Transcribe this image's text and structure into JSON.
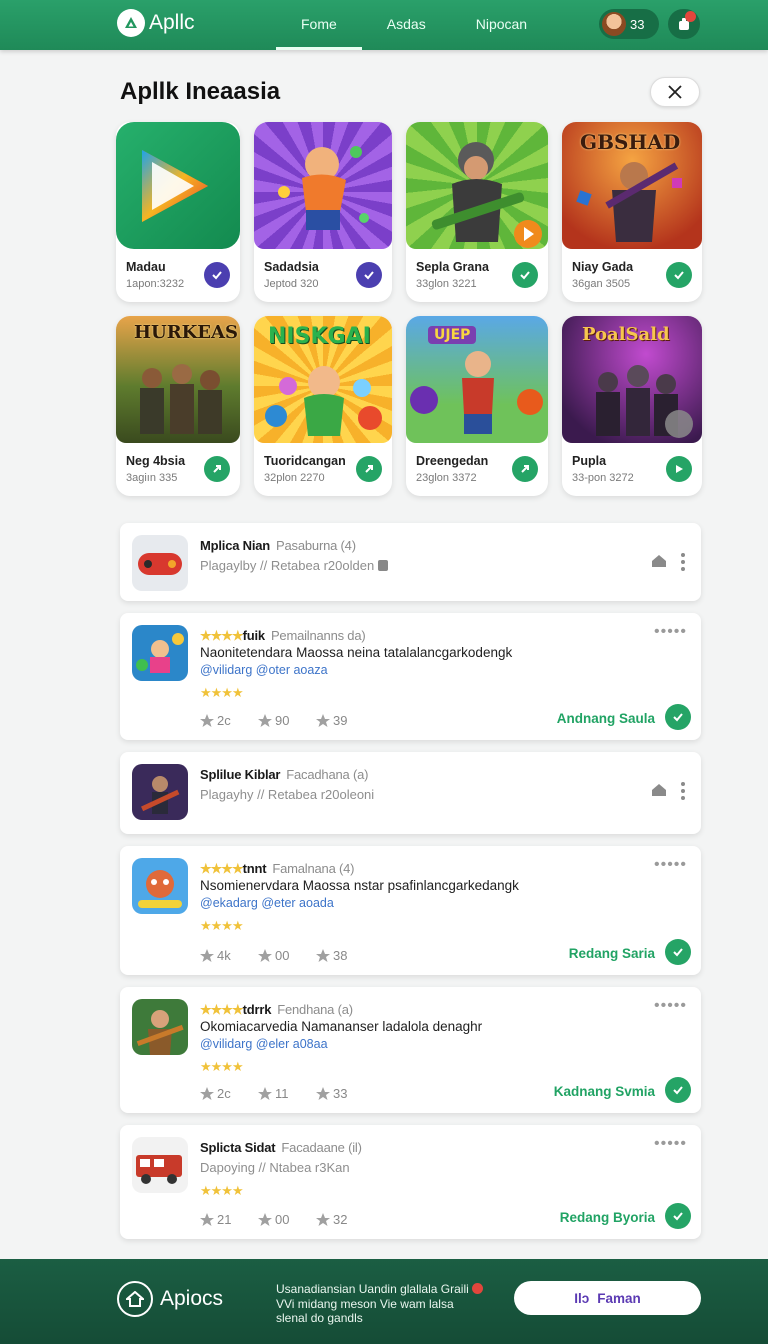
{
  "header": {
    "brand": "Apllc",
    "tabs": [
      {
        "label": "Fome",
        "active": true
      },
      {
        "label": "Asdas",
        "active": false
      },
      {
        "label": "Nipocan",
        "active": false
      }
    ],
    "user_count": "33",
    "accent": "#2aa06a"
  },
  "section": {
    "title": "Apllk Ineaasia"
  },
  "apps": [
    {
      "name": "Madau",
      "sub": "1apon:3232",
      "check_color": "#4b3fb0"
    },
    {
      "name": "Sadadsia",
      "sub": "Jeptod 320",
      "check_color": "#4b3fb0"
    },
    {
      "name": "Sepla Grana",
      "sub": "33glon 3221",
      "check_color": "#25a466"
    },
    {
      "name": "Niay Gada",
      "sub": "36gan 3505",
      "check_color": "#25a466"
    },
    {
      "name": "Neg 4bsia",
      "sub": "3agiın 335",
      "check_color": "#25a466"
    },
    {
      "name": "Tuoridcangan",
      "sub": "32plon 2270",
      "check_color": "#25a466"
    },
    {
      "name": "Dreengedan",
      "sub": "23glon 3372",
      "check_color": "#25a466"
    },
    {
      "name": "Pupla",
      "sub": "33-pon 3272",
      "check_color": "#25a466"
    }
  ],
  "app_thumb_labels": {
    "t3": "GBSHAD",
    "t4": "HURKEAS",
    "t5": "NISKGAI",
    "t6": "UJEP",
    "t7": "PoalSald"
  },
  "list": {
    "r1": {
      "title": "Mplica Nian",
      "meta": "Pasaburna (4)",
      "sub": "Plagaylby // Retabea r20olden"
    },
    "r2": {
      "stars": "★★★★",
      "title": "fuik",
      "meta": "Pemailnanns da)",
      "desc": "Naonitetendara  Maossa  neina  tatalalancgarkodengk",
      "link": "@vilidarg @oter aoaza",
      "stars2": "★★★★",
      "m1": "2c",
      "m2": "90",
      "m3": "39",
      "action": "Andnang Saula"
    },
    "r3": {
      "title": "Splilue Kiblar",
      "meta": "Facadhana (a)",
      "sub": "Plagayhy // Retabea r20oleoni"
    },
    "r4": {
      "stars": "★★★★",
      "title": "tnnt",
      "meta": "Famalnana (4)",
      "desc": "Nsomienervdara  Maossa  nstar  psafinlancgarkedangk",
      "link": "@ekadarg @eter aoada",
      "stars2": "★★★★",
      "m1": "4k",
      "m2": "00",
      "m3": "38",
      "action": "Redang Saria"
    },
    "r5": {
      "stars": "★★★★",
      "title": "tdrrk",
      "meta": "Fendhana (a)",
      "desc": "Okomiacarvedia  Namananser  ladalola  denaghr",
      "link": "@vilidarg @eler a08aa",
      "stars2": "★★★★",
      "m1": "2c",
      "m2": "11",
      "m3": "33",
      "action": "Kadnang Svmia"
    },
    "r6": {
      "title": "Splicta Sidat",
      "meta": "Facadaane (il)",
      "sub": "Dapoying // Ntabea r3Kan",
      "stars2": "★★★★",
      "m1": "21",
      "m2": "00",
      "m3": "32",
      "action": "Redang Byoria"
    }
  },
  "footer": {
    "brand": "Apiocs",
    "text1": "Usanadiansian Uandin glallala Graili",
    "text2": "VVi midang meson Vie wam lalsa",
    "text3": "slenal do gandls",
    "button": "Faman",
    "button_icon": "Ilɔ"
  }
}
